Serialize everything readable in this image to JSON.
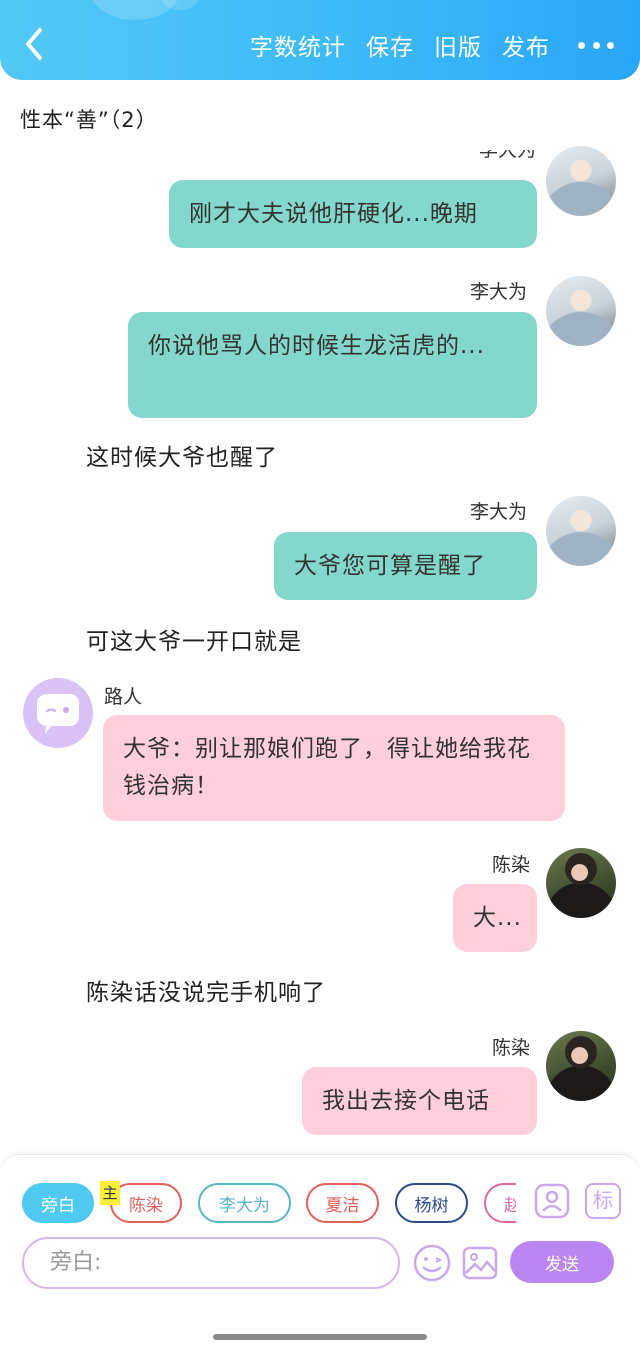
{
  "header": {
    "actions": [
      "字数统计",
      "保存",
      "旧版",
      "发布"
    ],
    "colors": {
      "gradient_start": "#52c8f4",
      "gradient_end": "#2aa6f7"
    }
  },
  "chapter": {
    "title": "性本“善”（2）"
  },
  "messages": [
    {
      "type": "character",
      "side": "right",
      "name": "李大为",
      "text": "刚才大夫说他肝硬化...晚期",
      "color": "#84d8cb"
    },
    {
      "type": "character",
      "side": "right",
      "name": "李大为",
      "text": "你说他骂人的时候生龙活虎的...",
      "color": "#84d8cb"
    },
    {
      "type": "narration",
      "text": "这时候大爷也醒了"
    },
    {
      "type": "character",
      "side": "right",
      "name": "李大为",
      "text": "大爷您可算是醒了",
      "color": "#84d8cb"
    },
    {
      "type": "narration",
      "text": "可这大爷一开口就是"
    },
    {
      "type": "character",
      "side": "left",
      "name": "路人",
      "text": "大爷：别让那娘们跑了，得让她给我花钱治病！",
      "color": "#ffcfdc"
    },
    {
      "type": "character",
      "side": "right",
      "name": "陈染",
      "text": "大...",
      "color": "#ffcfdc"
    },
    {
      "type": "narration",
      "text": "陈染话没说完手机响了"
    },
    {
      "type": "character",
      "side": "right",
      "name": "陈染",
      "text": "我出去接个电话",
      "color": "#ffcfdc"
    }
  ],
  "composer": {
    "roles": [
      {
        "label": "旁白",
        "color": "#4fc9ef",
        "active": true
      },
      {
        "label": "陈染",
        "color": "#e0605a",
        "active": false
      },
      {
        "label": "李大为",
        "color": "#5ab6c4",
        "active": false
      },
      {
        "label": "夏洁",
        "color": "#e0605a",
        "active": false
      },
      {
        "label": "杨树",
        "color": "#2a4a8a",
        "active": false
      },
      {
        "label": "赵",
        "color": "#e06aa0",
        "active": false
      }
    ],
    "main_badge": "主",
    "tag_label": "标",
    "input_placeholder": "旁白:",
    "send_label": "发送"
  }
}
